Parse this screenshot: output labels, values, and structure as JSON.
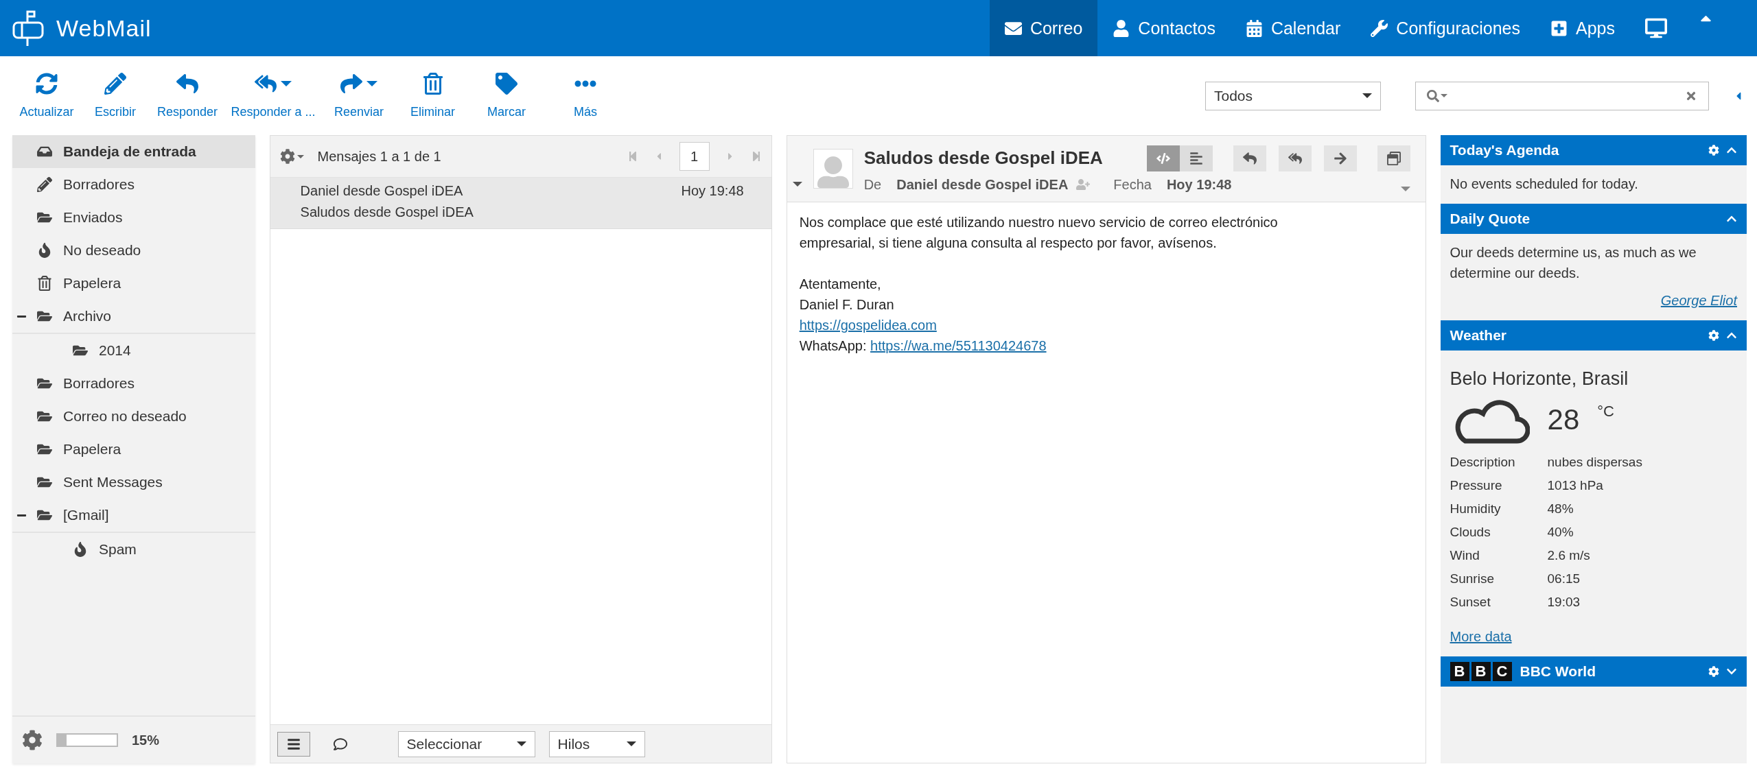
{
  "header": {
    "logo": "WebMail",
    "nav": [
      {
        "label": "Correo",
        "selected": true
      },
      {
        "label": "Contactos",
        "selected": false
      },
      {
        "label": "Calendar",
        "selected": false
      },
      {
        "label": "Configuraciones",
        "selected": false
      },
      {
        "label": "Apps",
        "selected": false
      }
    ]
  },
  "toolbar": {
    "buttons": [
      {
        "label": "Actualizar",
        "dropdown": false
      },
      {
        "label": "Escribir",
        "dropdown": false
      },
      {
        "label": "Responder",
        "dropdown": false
      },
      {
        "label": "Responder a ...",
        "dropdown": true
      },
      {
        "label": "Reenviar",
        "dropdown": true
      },
      {
        "label": "Eliminar",
        "dropdown": false
      },
      {
        "label": "Marcar",
        "dropdown": false
      },
      {
        "label": "Más",
        "dropdown": false
      }
    ],
    "filter": "Todos"
  },
  "folders": [
    {
      "label": "Bandeja de entrada",
      "kind": "inbox",
      "selected": true
    },
    {
      "label": "Borradores",
      "kind": "drafts",
      "selected": false
    },
    {
      "label": "Enviados",
      "kind": "folder",
      "selected": false
    },
    {
      "label": "No deseado",
      "kind": "junk",
      "selected": false
    },
    {
      "label": "Papelera",
      "kind": "trash",
      "selected": false
    },
    {
      "label": "Archivo",
      "kind": "folder",
      "selected": false,
      "expanded": true,
      "children": [
        {
          "label": "2014",
          "kind": "folder",
          "selected": false
        }
      ]
    },
    {
      "label": "Borradores",
      "kind": "folder",
      "selected": false
    },
    {
      "label": "Correo no deseado",
      "kind": "folder",
      "selected": false
    },
    {
      "label": "Papelera",
      "kind": "folder",
      "selected": false
    },
    {
      "label": "Sent Messages",
      "kind": "folder",
      "selected": false
    },
    {
      "label": "[Gmail]",
      "kind": "folder",
      "selected": false,
      "expanded": true,
      "children": [
        {
          "label": "Spam",
          "kind": "junk",
          "selected": false
        }
      ]
    }
  ],
  "quota": {
    "level": 0.15,
    "reading": "15%"
  },
  "message_list": {
    "count": "Mensajes 1 a 1 de 1",
    "page": "1",
    "messages": [
      {
        "from": "Daniel desde Gospel iDEA",
        "date": "Hoy 19:48",
        "subject": "Saludos desde Gospel iDEA",
        "selected": true
      }
    ],
    "select": "Seleccionar",
    "threads": "Hilos"
  },
  "message": {
    "subject": "Saludos desde Gospel iDEA",
    "from_label": "De",
    "from": "Daniel desde Gospel iDEA",
    "date_label": "Fecha",
    "date": "Hoy 19:48",
    "html_view": true,
    "paragraph": "Nos complace que esté utilizando nuestro nuevo servicio de correo electrónico empresarial, si tiene alguna consulta al respecto por favor, avísenos.",
    "closing": [
      "Atentamente,",
      "Daniel F. Duran"
    ],
    "website": "https://gospelidea.com",
    "whatsapp_label": "WhatsApp:",
    "whatsapp_link": "https://wa.me/551130424678"
  },
  "widgets": {
    "agenda": {
      "title": "Today's Agenda",
      "text": "No events scheduled for today."
    },
    "quote": {
      "title": "Daily Quote",
      "text": "Our deeds determine us, as much as we determine our deeds.",
      "author": "George Eliot"
    },
    "weather": {
      "title": "Weather",
      "city": "Belo Horizonte, Brasil",
      "temperature": "28",
      "unit": "°C",
      "rows": [
        {
          "label": "Description",
          "value": "nubes dispersas"
        },
        {
          "label": "Pressure",
          "value": "1013 hPa"
        },
        {
          "label": "Humidity",
          "value": "48%"
        },
        {
          "label": "Clouds",
          "value": "40%"
        },
        {
          "label": "Wind",
          "value": "2.6 m/s"
        },
        {
          "label": "Sunrise",
          "value": "06:15"
        },
        {
          "label": "Sunset",
          "value": "19:03"
        }
      ],
      "more": "More data"
    },
    "news": {
      "logo": [
        "B",
        "B",
        "C"
      ],
      "title": "BBC World",
      "expanded": false
    }
  }
}
